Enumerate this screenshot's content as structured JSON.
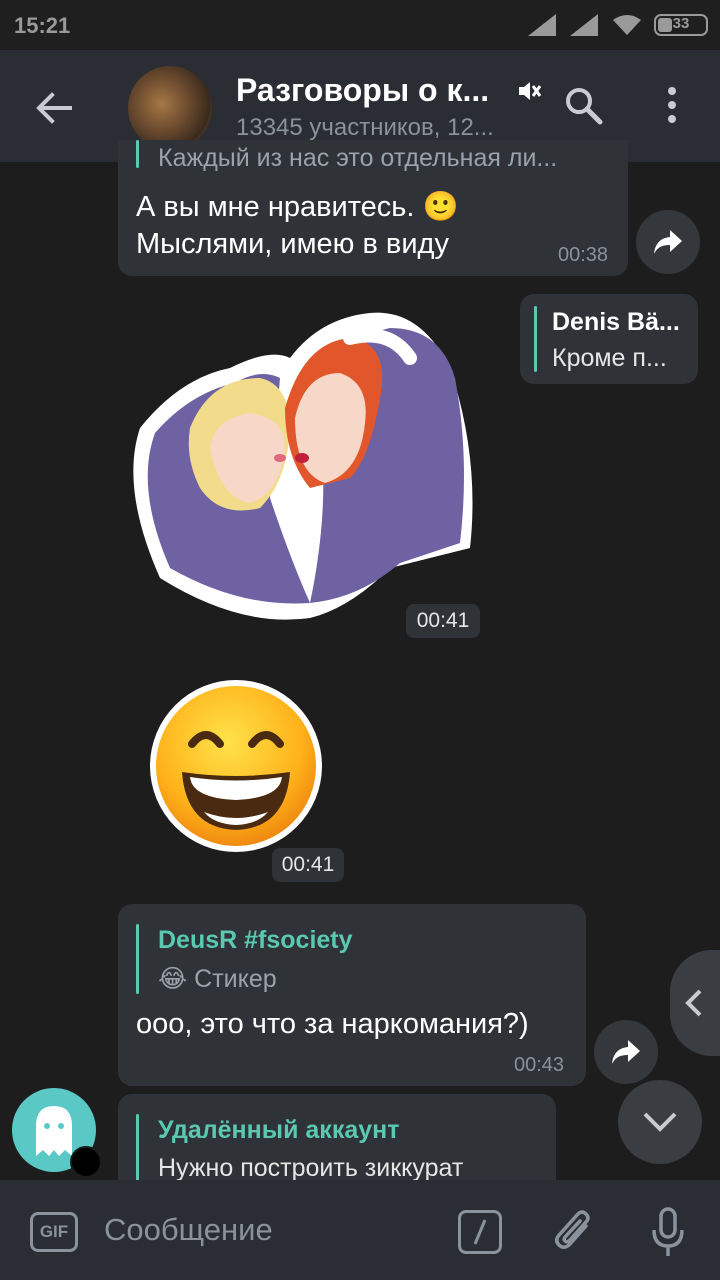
{
  "status": {
    "time": "15:21",
    "battery": "33"
  },
  "header": {
    "title": "Разговоры о к...",
    "subtitle": "13345 участников, 12..."
  },
  "messages": {
    "m1": {
      "cut_quote": "Каждый из нас это отдельная ли...",
      "line1": "А вы мне нравитесь. 🙂",
      "line2": "Мыслями, имею в виду",
      "time": "00:38"
    },
    "m2": {
      "quote_name": "Denis Bä...",
      "quote_text": "Кроме п..."
    },
    "sticker1": {
      "time": "00:41"
    },
    "sticker2": {
      "time": "00:41"
    },
    "m3": {
      "quote_name": "DeusR #fsociety",
      "quote_text": "😂 Стикер",
      "text": "ооо, это что за наркомания?)",
      "time": "00:43"
    },
    "m4": {
      "quote_name": "Удалённый аккаунт",
      "quote_text": "Нужно построить зиккурат"
    }
  },
  "input": {
    "placeholder": "Сообщение",
    "gif_label": "GIF"
  },
  "colors": {
    "accent": "#5ac9b0",
    "bubble": "#2f3237",
    "background": "#1d1d1d",
    "header": "#2a2d33"
  }
}
